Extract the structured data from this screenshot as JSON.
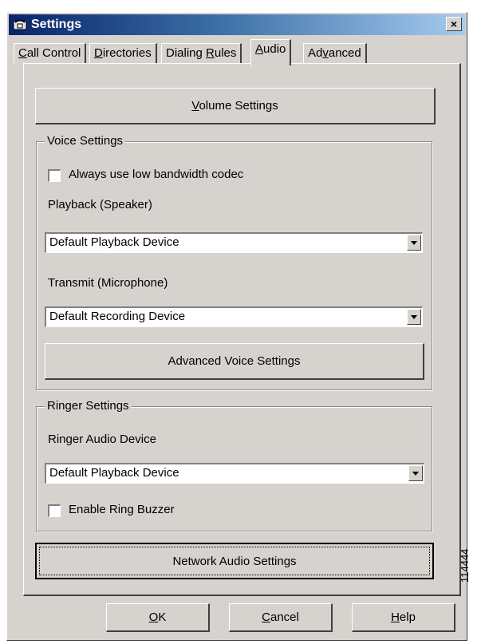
{
  "window": {
    "title": "Settings",
    "close_label": "×"
  },
  "tabs": [
    {
      "label": "Call Control",
      "accel": "C",
      "rest": "all Control"
    },
    {
      "label": "Directories",
      "accel": "D",
      "rest": "irectories"
    },
    {
      "label": "Dialing Rules",
      "pre": "Dialing ",
      "accel": "R",
      "rest": "ules"
    },
    {
      "label": "Audio",
      "accel": "A",
      "rest": "udio",
      "active": true
    },
    {
      "label": "Advanced",
      "pre": "Ad",
      "accel": "v",
      "rest": "anced"
    }
  ],
  "audio": {
    "volume_button": {
      "accel": "V",
      "rest": "olume Settings"
    },
    "voice_group": {
      "label": "Voice Settings",
      "low_bandwidth_label": "Always use low bandwidth codec",
      "low_bandwidth_checked": false,
      "playback_label": "Playback (Speaker)",
      "playback_value": "Default Playback Device",
      "transmit_label": "Transmit (Microphone)",
      "transmit_value": "Default Recording Device",
      "advanced_button": "Advanced Voice Settings"
    },
    "ringer_group": {
      "label": "Ringer Settings",
      "device_label": "Ringer Audio Device",
      "device_value": "Default Playback Device",
      "buzzer_label": "Enable Ring Buzzer",
      "buzzer_checked": false
    },
    "network_button": "Network Audio Settings"
  },
  "footer": {
    "ok": {
      "accel": "O",
      "rest": "K"
    },
    "cancel": {
      "accel": "C",
      "rest": "ancel"
    },
    "help": {
      "accel": "H",
      "rest": "elp"
    }
  },
  "side_id": "114444"
}
